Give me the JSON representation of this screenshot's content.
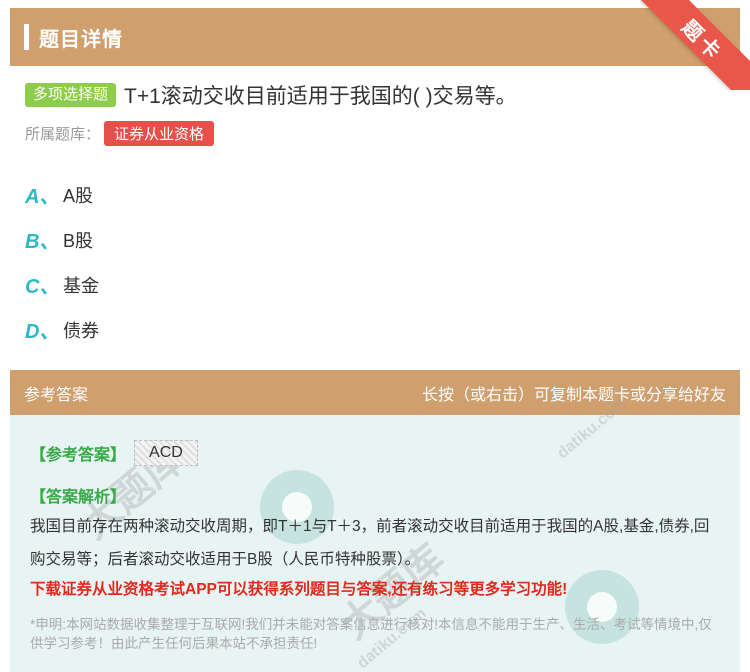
{
  "header": {
    "title": "题目详情"
  },
  "ribbon": {
    "label": "题卡"
  },
  "question": {
    "type": "多项选择题",
    "text": "T+1滚动交收目前适用于我国的( )交易等。"
  },
  "bank": {
    "label": "所属题库：",
    "tag": "证券从业资格"
  },
  "options": [
    {
      "letter": "A、",
      "text": "A股"
    },
    {
      "letter": "B、",
      "text": "B股"
    },
    {
      "letter": "C、",
      "text": "基金"
    },
    {
      "letter": "D、",
      "text": "债券"
    }
  ],
  "answer": {
    "section_title": "参考答案",
    "hint": "长按（或右击）可复制本题卡或分享给好友",
    "answer_label": "【参考答案】",
    "answer_value": "ACD",
    "explanation_label": "【答案解析】",
    "explanation": "我国目前存在两种滚动交收周期，即T＋1与T＋3，前者滚动交收目前适用于我国的A股,基金,债券,回购交易等；后者滚动交收适用于B股（人民币特种股票）。",
    "promo": "下载证券从业资格考试APP可以获得系列题目与答案,还有练习等更多学习功能!",
    "disclaimer": "*申明:本网站数据收集整理于互联网!我们并未能对答案信息进行核对!本信息不能用于生产、生活、考试等情境中,仅供学习参考！由此产生任何后果本站不承担责任!"
  },
  "watermark": {
    "text": "大题库",
    "site": "datiku.com"
  }
}
